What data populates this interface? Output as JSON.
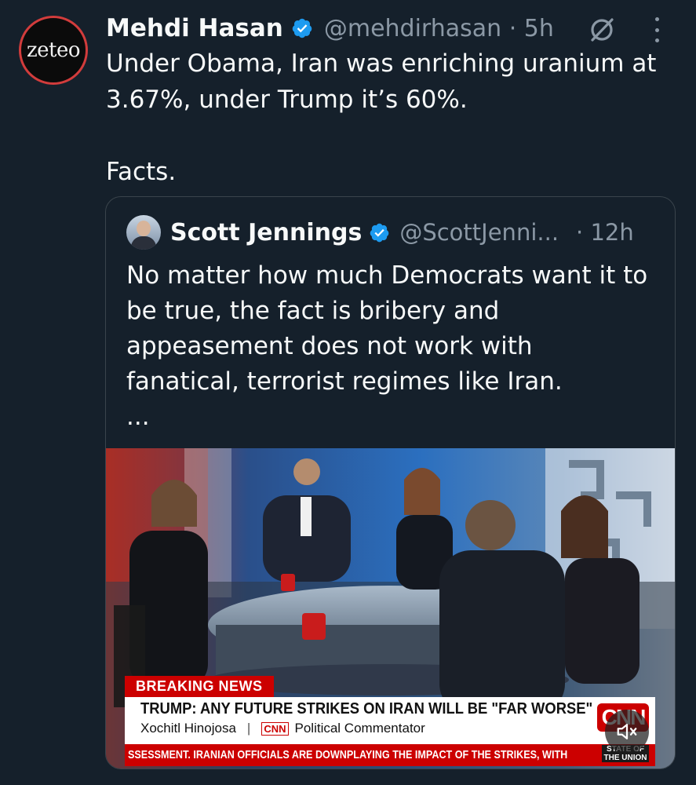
{
  "tweet": {
    "avatar_text": "zeteo",
    "author_name": "Mehdi Hasan",
    "handle_time": "@mehdirhasan · 5h",
    "text_lines": [
      "Under Obama, Iran was enriching uranium at",
      "3.67%, under Trump it’s 60%."
    ],
    "text_tail": "Facts.",
    "icons": {
      "verified": "verified-badge-icon",
      "grok": "grok-icon",
      "more": "more-vertical-icon"
    },
    "colors": {
      "background": "#15202b",
      "verified": "#1d9bf0",
      "muted_text": "#8b98a5"
    }
  },
  "quote": {
    "author_name": "Scott Jennings",
    "handle": "@ScottJenni...",
    "time": "· 12h",
    "text_lines": [
      "No matter how much Democrats want it to",
      "be true, the fact is bribery and",
      "appeasement does not work with",
      "fanatical, terrorist regimes like Iran.",
      "..."
    ],
    "video": {
      "breaking_label": "BREAKING NEWS",
      "headline": "TRUMP: ANY FUTURE STRIKES ON IRAN WILL BE \"FAR WORSE\"",
      "guest_name": "Xochitl Hinojosa",
      "guest_network": "CNN",
      "guest_title": "Political Commentator",
      "network_logo": "CNN",
      "ticker": "SSESSMENT. IRANIAN OFFICIALS ARE DOWNPLAYING THE IMPACT OF THE STRIKES, WITH",
      "show_badge": "STATE OF THE UNION",
      "mute_icon": "volume-muted-icon"
    }
  }
}
